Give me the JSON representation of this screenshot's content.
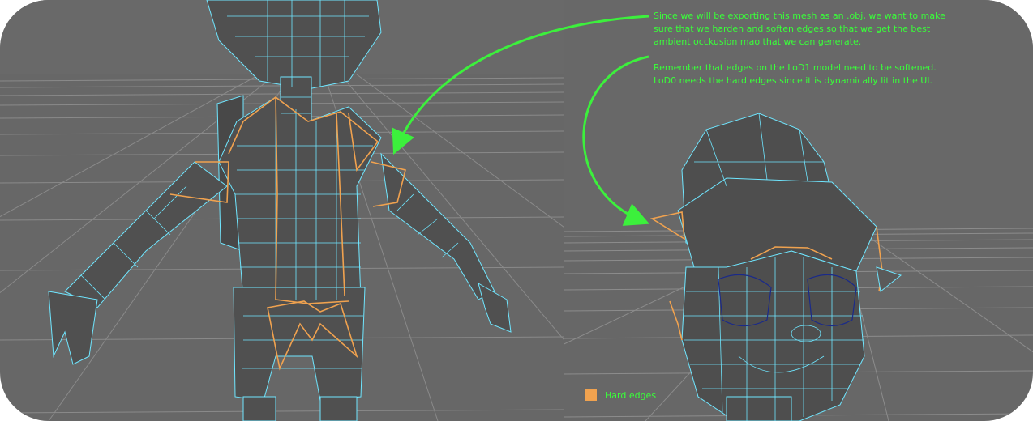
{
  "annotation": {
    "paragraph_1": "Since we will be exporting this mesh as an .obj, we want to make sure that we harden and soften edges so that we get the best ambient occkusion mao that we can generate.",
    "paragraph_2": "Remember that edges on the LoD1 model need to be softened. LoD0 needs the hard edges since it is dynamically lit in the UI."
  },
  "legend": {
    "label": "Hard edges",
    "swatch_color": "#f0a24f"
  },
  "colors": {
    "annotation_text": "#39ff39",
    "arrow": "#3cf03c",
    "wireframe": "#6fe6ff",
    "hard_edge": "#f0a24f",
    "mesh_fill": "#505050",
    "viewport_bg": "#676767"
  }
}
